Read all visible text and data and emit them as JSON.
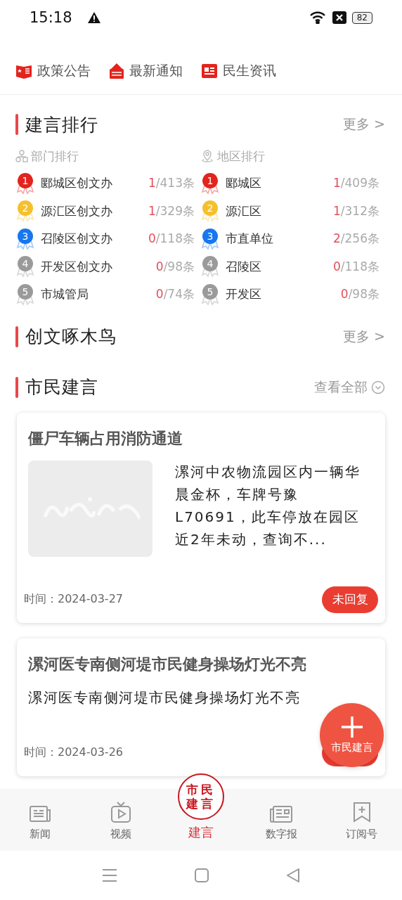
{
  "status_bar": {
    "time": "15:18",
    "battery": "82"
  },
  "top_tabs": [
    {
      "label": "政策公告",
      "kind": "book"
    },
    {
      "label": "最新通知",
      "kind": "notice"
    },
    {
      "label": "民生资讯",
      "kind": "news"
    }
  ],
  "ranking": {
    "title": "建言排行",
    "more": "更多 >",
    "columns": [
      {
        "title": "部门排行",
        "kind": "org",
        "rows": [
          {
            "rank": "1",
            "color": "#e3241d",
            "name": "郾城区创文办",
            "done": "1",
            "total": "/413条"
          },
          {
            "rank": "2",
            "color": "#f5c02c",
            "name": "源汇区创文办",
            "done": "1",
            "total": "/329条"
          },
          {
            "rank": "3",
            "color": "#1677f0",
            "name": "召陵区创文办",
            "done": "0",
            "total": "/118条"
          },
          {
            "rank": "4",
            "color": "#9a9a9a",
            "name": "开发区创文办",
            "done": "0",
            "total": "/98条"
          },
          {
            "rank": "5",
            "color": "#9a9a9a",
            "name": "市城管局",
            "done": "0",
            "total": "/74条"
          }
        ]
      },
      {
        "title": "地区排行",
        "kind": "location",
        "rows": [
          {
            "rank": "1",
            "color": "#e3241d",
            "name": "郾城区",
            "done": "1",
            "total": "/409条"
          },
          {
            "rank": "2",
            "color": "#f5c02c",
            "name": "源汇区",
            "done": "1",
            "total": "/312条"
          },
          {
            "rank": "3",
            "color": "#1677f0",
            "name": "市直单位",
            "done": "2",
            "total": "/256条"
          },
          {
            "rank": "4",
            "color": "#9a9a9a",
            "name": "召陵区",
            "done": "0",
            "total": "/118条"
          },
          {
            "rank": "5",
            "color": "#9a9a9a",
            "name": "开发区",
            "done": "0",
            "total": "/98条"
          }
        ]
      }
    ]
  },
  "woodpecker": {
    "title": "创文啄木鸟",
    "more": "更多 >"
  },
  "citizen": {
    "title": "市民建言",
    "more": "查看全部",
    "cards": [
      {
        "title": "僵尸车辆占用消防通道",
        "has_image": true,
        "summary": "漯河中农物流园区内一辆华晨金杯，车牌号豫L70691，此车停放在园区近2年未动，查询不...",
        "time": "时间：2024-03-27",
        "replied": false,
        "status": "未回复"
      },
      {
        "title": "漯河医专南侧河堤市民健身操场灯光不亮",
        "has_image": false,
        "summary": "漯河医专南侧河堤市民健身操场灯光不亮",
        "time": "时间：2024-03-26",
        "replied": false
      }
    ]
  },
  "fab": {
    "label": "市民建言"
  },
  "bottom_nav": [
    {
      "label": "新闻",
      "kind": "news",
      "selected": false
    },
    {
      "label": "视频",
      "kind": "video",
      "selected": false
    },
    {
      "label": "建言",
      "kind": "stamp",
      "stamp": [
        "市民",
        "建言"
      ],
      "selected": true
    },
    {
      "label": "数字报",
      "kind": "paper",
      "selected": false
    },
    {
      "label": "订阅号",
      "kind": "subscribe",
      "selected": false
    }
  ]
}
